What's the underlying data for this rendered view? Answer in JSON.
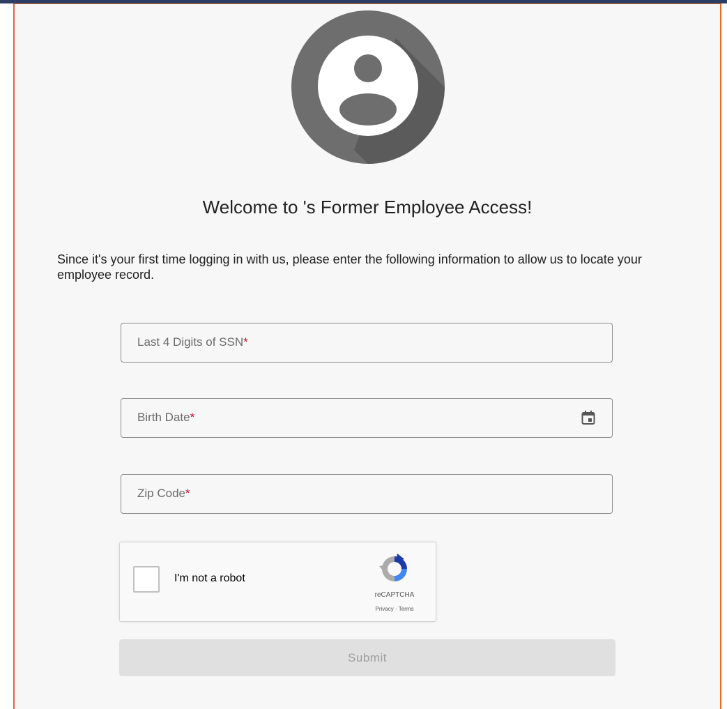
{
  "header": {
    "title": "Welcome to 's Former Employee Access!",
    "intro": "Since it's your first time logging in with us, please enter the following information to allow us to locate your employee record."
  },
  "form": {
    "ssn_label": "Last 4 Digits of SSN",
    "birth_label": "Birth Date",
    "zip_label": "Zip Code",
    "required_mark": "*",
    "submit_label": "Submit"
  },
  "captcha": {
    "label": "I'm not a robot",
    "brand": "reCAPTCHA",
    "privacy": "Privacy",
    "separator": " · ",
    "terms": "Terms"
  },
  "icons": {
    "avatar": "user-avatar-icon",
    "calendar": "calendar-icon",
    "recaptcha": "recaptcha-logo-icon"
  },
  "colors": {
    "frame_border": "#e2692a",
    "top_bar": "#2c3e63",
    "avatar_circle": "#6e6e6e",
    "required": "#c8102e",
    "submit_disabled_bg": "#e0e0e0"
  }
}
